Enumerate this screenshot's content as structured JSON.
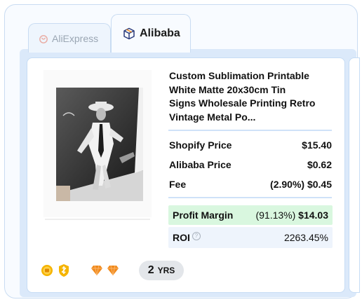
{
  "tabs": [
    {
      "label": "AliExpress",
      "icon": "aliexpress-logo-icon",
      "active": false
    },
    {
      "label": "Alibaba",
      "icon": "box-icon",
      "active": true
    }
  ],
  "product": {
    "title_lines": [
      "Custom Sublimation Printable",
      "White Matte 20x30cm Tin",
      "Signs Wholesale Printing Retro",
      "Vintage Metal Po..."
    ]
  },
  "pricing": {
    "shopify_label": "Shopify Price",
    "shopify_value": "$15.40",
    "alibaba_label": "Alibaba Price",
    "alibaba_value": "$0.62",
    "fee_label": "Fee",
    "fee_value": "(2.90%) $0.45",
    "profit_label": "Profit Margin",
    "profit_percent": "(91.13%)",
    "profit_value": "$14.03",
    "roi_label": "ROI",
    "roi_help": "?",
    "roi_value": "2263.45%"
  },
  "supplier": {
    "badges": [
      "gold-supplier-icon",
      "verified-shield-icon",
      "diamond-icon",
      "diamond-icon"
    ],
    "years_number": "2",
    "years_unit": "YRS"
  },
  "colors": {
    "accent_border": "#c9dcf2",
    "profit_bg": "#d9f7df",
    "roi_bg": "#eef4fc",
    "badge_gold": "#f5b400",
    "diamond_orange": "#f08a1c"
  }
}
